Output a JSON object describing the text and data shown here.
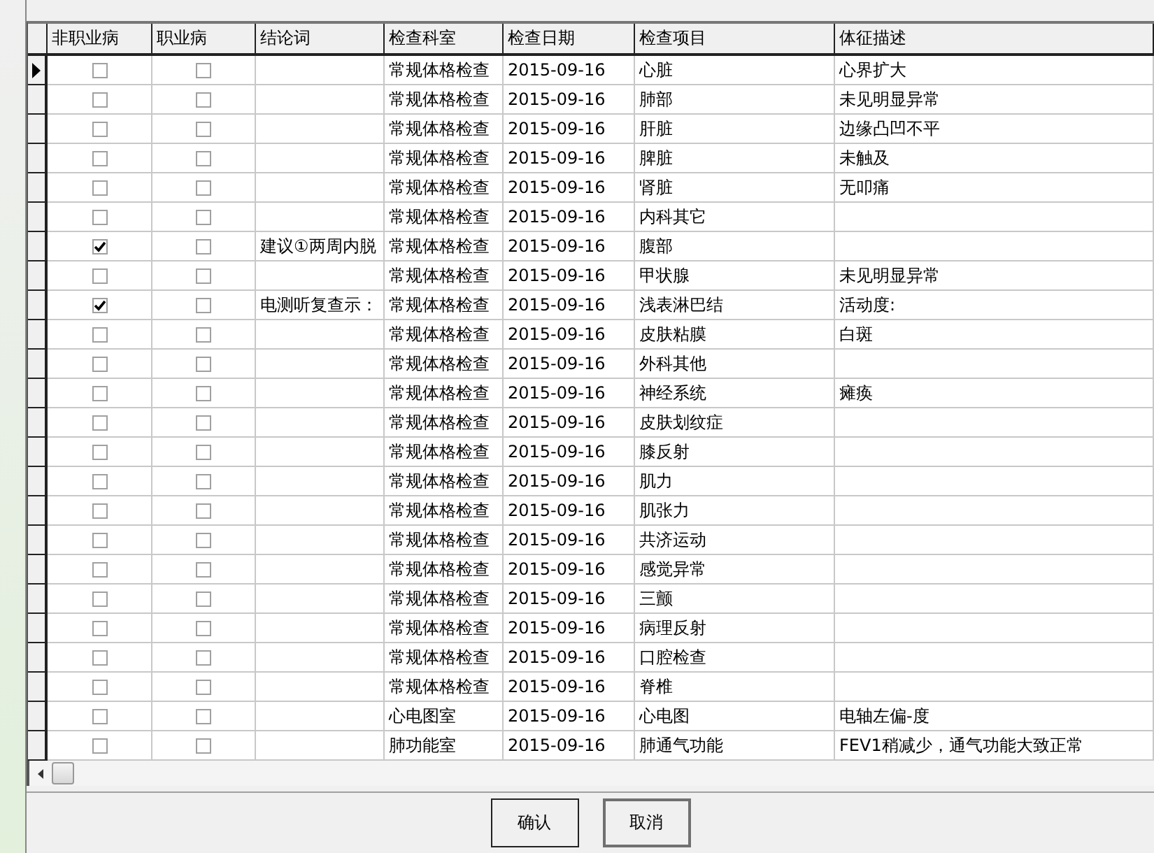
{
  "grid": {
    "columns": [
      "非职业病",
      "职业病",
      "结论词",
      "检查科室",
      "检查日期",
      "检查项目",
      "体征描述"
    ],
    "rows": [
      {
        "current": true,
        "non_occupational": false,
        "occupational": false,
        "conclusion": "",
        "department": "常规体格检查",
        "date": "2015-09-16",
        "item": "心脏",
        "finding": "心界扩大"
      },
      {
        "current": false,
        "non_occupational": false,
        "occupational": false,
        "conclusion": "",
        "department": "常规体格检查",
        "date": "2015-09-16",
        "item": "肺部",
        "finding": "未见明显异常"
      },
      {
        "current": false,
        "non_occupational": false,
        "occupational": false,
        "conclusion": "",
        "department": "常规体格检查",
        "date": "2015-09-16",
        "item": "肝脏",
        "finding": "边缘凸凹不平"
      },
      {
        "current": false,
        "non_occupational": false,
        "occupational": false,
        "conclusion": "",
        "department": "常规体格检查",
        "date": "2015-09-16",
        "item": "脾脏",
        "finding": "未触及"
      },
      {
        "current": false,
        "non_occupational": false,
        "occupational": false,
        "conclusion": "",
        "department": "常规体格检查",
        "date": "2015-09-16",
        "item": "肾脏",
        "finding": "无叩痛"
      },
      {
        "current": false,
        "non_occupational": false,
        "occupational": false,
        "conclusion": "",
        "department": "常规体格检查",
        "date": "2015-09-16",
        "item": "内科其它",
        "finding": ""
      },
      {
        "current": false,
        "non_occupational": true,
        "occupational": false,
        "conclusion": "建议①两周内脱",
        "department": "常规体格检查",
        "date": "2015-09-16",
        "item": "腹部",
        "finding": ""
      },
      {
        "current": false,
        "non_occupational": false,
        "occupational": false,
        "conclusion": "",
        "department": "常规体格检查",
        "date": "2015-09-16",
        "item": "甲状腺",
        "finding": "未见明显异常"
      },
      {
        "current": false,
        "non_occupational": true,
        "occupational": false,
        "conclusion": "电测听复查示：",
        "department": "常规体格检查",
        "date": "2015-09-16",
        "item": "浅表淋巴结",
        "finding": "活动度:"
      },
      {
        "current": false,
        "non_occupational": false,
        "occupational": false,
        "conclusion": "",
        "department": "常规体格检查",
        "date": "2015-09-16",
        "item": "皮肤粘膜",
        "finding": "白斑"
      },
      {
        "current": false,
        "non_occupational": false,
        "occupational": false,
        "conclusion": "",
        "department": "常规体格检查",
        "date": "2015-09-16",
        "item": "外科其他",
        "finding": ""
      },
      {
        "current": false,
        "non_occupational": false,
        "occupational": false,
        "conclusion": "",
        "department": "常规体格检查",
        "date": "2015-09-16",
        "item": "神经系统",
        "finding": "瘫痪"
      },
      {
        "current": false,
        "non_occupational": false,
        "occupational": false,
        "conclusion": "",
        "department": "常规体格检查",
        "date": "2015-09-16",
        "item": "皮肤划纹症",
        "finding": ""
      },
      {
        "current": false,
        "non_occupational": false,
        "occupational": false,
        "conclusion": "",
        "department": "常规体格检查",
        "date": "2015-09-16",
        "item": "膝反射",
        "finding": ""
      },
      {
        "current": false,
        "non_occupational": false,
        "occupational": false,
        "conclusion": "",
        "department": "常规体格检查",
        "date": "2015-09-16",
        "item": "肌力",
        "finding": ""
      },
      {
        "current": false,
        "non_occupational": false,
        "occupational": false,
        "conclusion": "",
        "department": "常规体格检查",
        "date": "2015-09-16",
        "item": "肌张力",
        "finding": ""
      },
      {
        "current": false,
        "non_occupational": false,
        "occupational": false,
        "conclusion": "",
        "department": "常规体格检查",
        "date": "2015-09-16",
        "item": "共济运动",
        "finding": ""
      },
      {
        "current": false,
        "non_occupational": false,
        "occupational": false,
        "conclusion": "",
        "department": "常规体格检查",
        "date": "2015-09-16",
        "item": "感觉异常",
        "finding": ""
      },
      {
        "current": false,
        "non_occupational": false,
        "occupational": false,
        "conclusion": "",
        "department": "常规体格检查",
        "date": "2015-09-16",
        "item": "三颤",
        "finding": ""
      },
      {
        "current": false,
        "non_occupational": false,
        "occupational": false,
        "conclusion": "",
        "department": "常规体格检查",
        "date": "2015-09-16",
        "item": "病理反射",
        "finding": ""
      },
      {
        "current": false,
        "non_occupational": false,
        "occupational": false,
        "conclusion": "",
        "department": "常规体格检查",
        "date": "2015-09-16",
        "item": "口腔检查",
        "finding": ""
      },
      {
        "current": false,
        "non_occupational": false,
        "occupational": false,
        "conclusion": "",
        "department": "常规体格检查",
        "date": "2015-09-16",
        "item": "脊椎",
        "finding": ""
      },
      {
        "current": false,
        "non_occupational": false,
        "occupational": false,
        "conclusion": "",
        "department": "心电图室",
        "date": "2015-09-16",
        "item": "心电图",
        "finding": "电轴左偏-度"
      },
      {
        "current": false,
        "non_occupational": false,
        "occupational": false,
        "conclusion": "",
        "department": "肺功能室",
        "date": "2015-09-16",
        "item": "肺通气功能",
        "finding": "FEV1稍减少，通气功能大致正常"
      }
    ]
  },
  "buttons": [
    {
      "label": "确认",
      "focused": false
    },
    {
      "label": "取消",
      "focused": true
    }
  ]
}
